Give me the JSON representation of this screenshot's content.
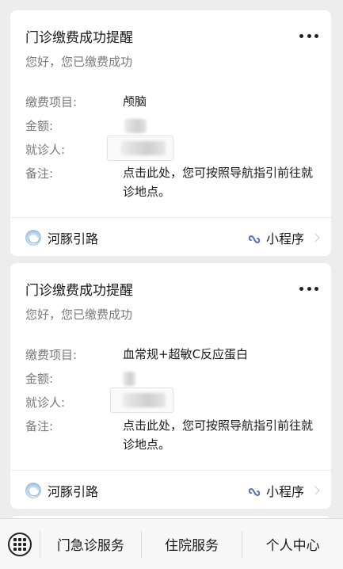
{
  "cards": [
    {
      "title": "门诊缴费成功提醒",
      "subtitle": "您好，您已缴费成功",
      "fields": [
        {
          "label": "缴费项目:",
          "value": "颅脑"
        },
        {
          "label": "金额:",
          "value": ""
        },
        {
          "label": "就诊人:",
          "value": ""
        },
        {
          "label": "备注:",
          "value": "点击此处，您可按照导航指引前往就诊地点。"
        }
      ],
      "app_name": "河豚引路",
      "app_type": "小程序"
    },
    {
      "title": "门诊缴费成功提醒",
      "subtitle": "您好，您已缴费成功",
      "fields": [
        {
          "label": "缴费项目:",
          "value": "血常规+超敏C反应蛋白"
        },
        {
          "label": "金额:",
          "value": ""
        },
        {
          "label": "就诊人:",
          "value": ""
        },
        {
          "label": "备注:",
          "value": "点击此处，您可按照导航指引前往就诊地点。"
        }
      ],
      "app_name": "河豚引路",
      "app_type": "小程序"
    }
  ],
  "tabbar": {
    "tabs": [
      "门急诊服务",
      "住院服务",
      "个人中心"
    ]
  },
  "icons": {
    "more": "more-dots-icon",
    "app_logo": "pufferfish-logo-icon",
    "mini_program": "mini-program-link-icon",
    "keyboard": "keyboard-icon"
  }
}
